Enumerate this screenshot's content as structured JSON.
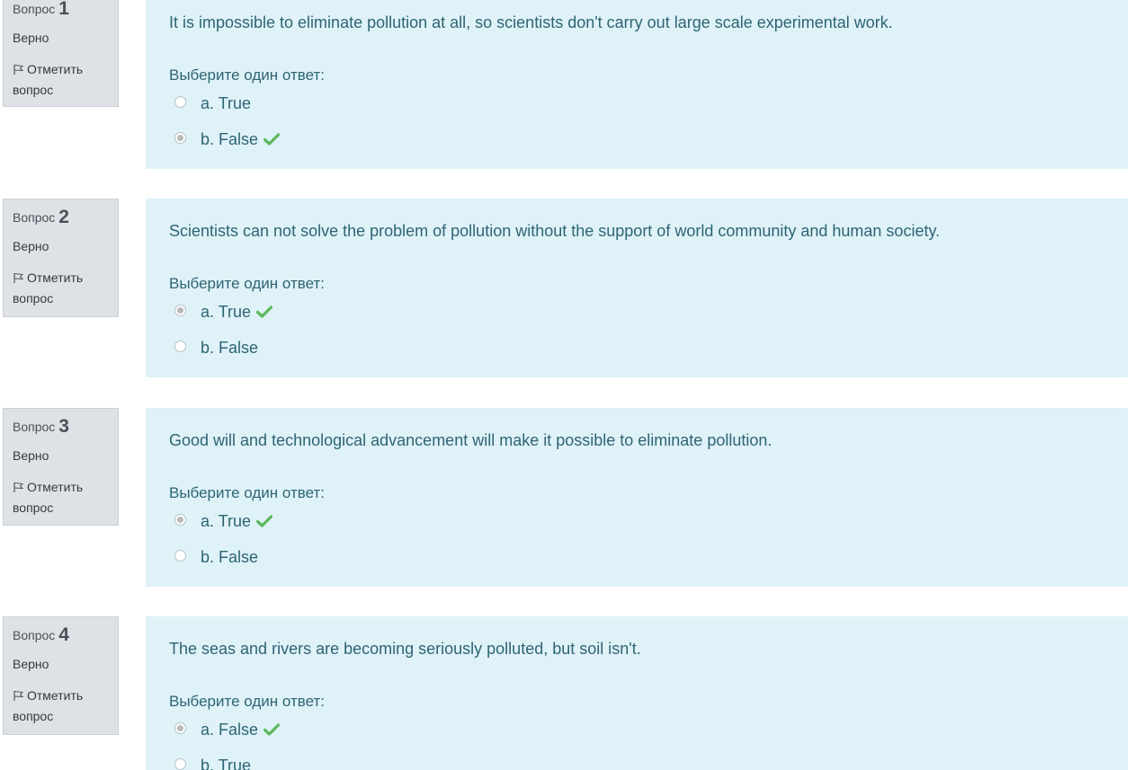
{
  "questions": [
    {
      "label": "Вопрос",
      "number": "1",
      "state": "Верно",
      "flag_label": "Отметить вопрос",
      "text": "It is impossible to eliminate pollution at all, so scientists don't carry out large scale experimental work.",
      "prompt": "Выберите один ответ:",
      "answers": [
        {
          "label": "a. True",
          "selected": false,
          "correct": false
        },
        {
          "label": "b. False",
          "selected": true,
          "correct": true
        }
      ]
    },
    {
      "label": "Вопрос",
      "number": "2",
      "state": "Верно",
      "flag_label": "Отметить вопрос",
      "text": "Scientists can not solve the problem of pollution without the support of world community and human society.",
      "prompt": "Выберите один ответ:",
      "answers": [
        {
          "label": "a. True",
          "selected": true,
          "correct": true
        },
        {
          "label": "b. False",
          "selected": false,
          "correct": false
        }
      ]
    },
    {
      "label": "Вопрос",
      "number": "3",
      "state": "Верно",
      "flag_label": "Отметить вопрос",
      "text": "Good will and technological advancement will make it possible to eliminate pollution.",
      "prompt": "Выберите один ответ:",
      "answers": [
        {
          "label": "a. True",
          "selected": true,
          "correct": true
        },
        {
          "label": "b. False",
          "selected": false,
          "correct": false
        }
      ]
    },
    {
      "label": "Вопрос",
      "number": "4",
      "state": "Верно",
      "flag_label": "Отметить вопрос",
      "text": "The seas and rivers are becoming seriously polluted, but soil isn't.",
      "prompt": "Выберите один ответ:",
      "answers": [
        {
          "label": "a. False",
          "selected": true,
          "correct": true
        },
        {
          "label": "b. True",
          "selected": false,
          "correct": false
        }
      ]
    }
  ],
  "colors": {
    "info_bg": "#dee2e6",
    "content_bg": "#def2f8",
    "text": "#2f6473",
    "correct_check": "#5cb85c"
  },
  "icons": {
    "flag": "flag-icon",
    "correct": "check-icon",
    "radio": "radio-icon"
  }
}
